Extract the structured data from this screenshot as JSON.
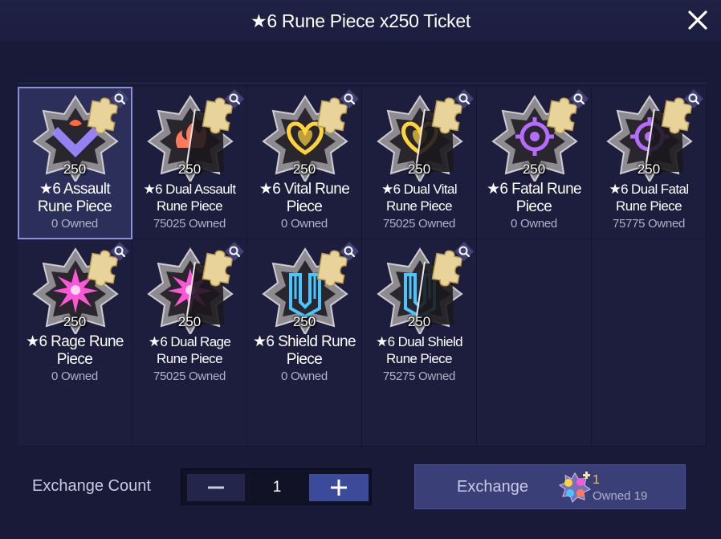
{
  "header": {
    "title": "★6 Rune Piece x250 Ticket"
  },
  "items": [
    {
      "name": "★6 Assault Rune Piece",
      "quantity": "250",
      "owned": "0 Owned",
      "color": "#9a86ff",
      "glyph": "V",
      "dual": false,
      "selected": true
    },
    {
      "name": "★6 Dual Assault Rune Piece",
      "quantity": "250",
      "owned": "75025 Owned",
      "color": "#ff7a5a",
      "glyph": "flame",
      "dual": true,
      "selected": false
    },
    {
      "name": "★6 Vital Rune Piece",
      "quantity": "250",
      "owned": "0 Owned",
      "color": "#ffd43a",
      "glyph": "heart",
      "dual": false,
      "selected": false
    },
    {
      "name": "★6 Dual Vital Rune Piece",
      "quantity": "250",
      "owned": "75025 Owned",
      "color": "#ffd43a",
      "glyph": "heart",
      "dual": true,
      "selected": false
    },
    {
      "name": "★6 Fatal Rune Piece",
      "quantity": "250",
      "owned": "0 Owned",
      "color": "#b66bff",
      "glyph": "target",
      "dual": false,
      "selected": false
    },
    {
      "name": "★6 Dual Fatal Rune Piece",
      "quantity": "250",
      "owned": "75775 Owned",
      "color": "#b66bff",
      "glyph": "target",
      "dual": true,
      "selected": false
    },
    {
      "name": "★6 Rage Rune Piece",
      "quantity": "250",
      "owned": "0 Owned",
      "color": "#ff56d8",
      "glyph": "burst",
      "dual": false,
      "selected": false
    },
    {
      "name": "★6 Dual Rage Rune Piece",
      "quantity": "250",
      "owned": "75025 Owned",
      "color": "#ff56d8",
      "glyph": "burst",
      "dual": true,
      "selected": false
    },
    {
      "name": "★6 Shield Rune Piece",
      "quantity": "250",
      "owned": "0 Owned",
      "color": "#49c6ff",
      "glyph": "shield",
      "dual": false,
      "selected": false
    },
    {
      "name": "★6 Dual Shield Rune Piece",
      "quantity": "250",
      "owned": "75275 Owned",
      "color": "#49c6ff",
      "glyph": "shield",
      "dual": true,
      "selected": false
    }
  ],
  "footer": {
    "exchange_count_label": "Exchange Count",
    "count_value": "1",
    "minus_icon": "minus-icon",
    "plus_icon": "plus-icon",
    "exchange_label": "Exchange",
    "ticket_count": "1",
    "ticket_owned": "Owned 19"
  },
  "colors": {
    "background": "#1b1c3c",
    "accent": "#3c4a9a",
    "ticket_count": "#f2c94c"
  }
}
